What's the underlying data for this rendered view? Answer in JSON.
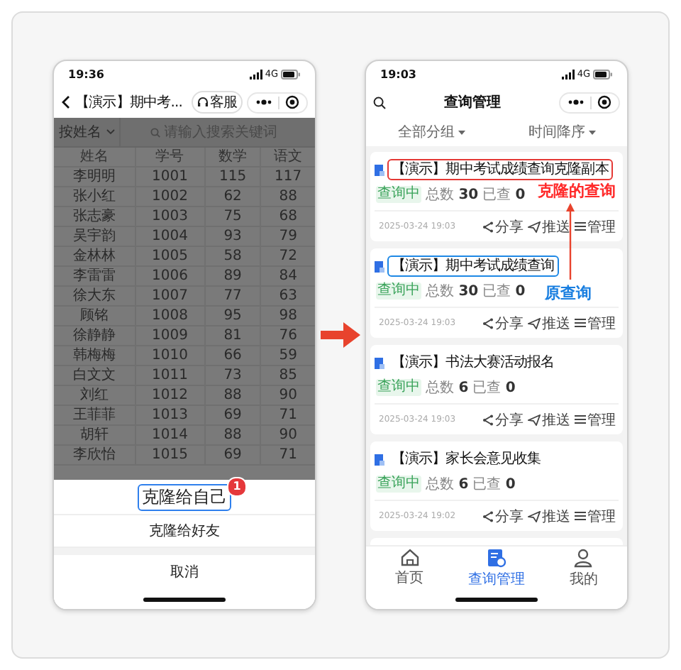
{
  "left_phone": {
    "status_bar": {
      "time": "19:36",
      "network": "4G"
    },
    "nav": {
      "title": "【演示】期中考...",
      "service_button": "客服"
    },
    "search": {
      "filter": "按姓名",
      "placeholder": "请输入搜索关键词"
    },
    "table": {
      "columns": [
        "姓名",
        "学号",
        "数学",
        "语文"
      ],
      "rows": [
        [
          "李明明",
          "1001",
          "115",
          "117"
        ],
        [
          "张小红",
          "1002",
          "62",
          "88"
        ],
        [
          "张志豪",
          "1003",
          "75",
          "68"
        ],
        [
          "吴宇韵",
          "1004",
          "93",
          "79"
        ],
        [
          "金林林",
          "1005",
          "58",
          "72"
        ],
        [
          "李雷雷",
          "1006",
          "89",
          "84"
        ],
        [
          "徐大东",
          "1007",
          "77",
          "63"
        ],
        [
          "顾铭",
          "1008",
          "95",
          "98"
        ],
        [
          "徐静静",
          "1009",
          "81",
          "76"
        ],
        [
          "韩梅梅",
          "1010",
          "66",
          "59"
        ],
        [
          "白文文",
          "1011",
          "73",
          "85"
        ],
        [
          "刘红",
          "1012",
          "88",
          "90"
        ],
        [
          "王菲菲",
          "1013",
          "69",
          "71"
        ],
        [
          "胡轩",
          "1014",
          "88",
          "90"
        ],
        [
          "李欣怡",
          "1015",
          "69",
          "71"
        ]
      ]
    },
    "action_sheet": {
      "items": [
        {
          "label": "克隆给自己",
          "highlighted": true,
          "badge": "1"
        },
        {
          "label": "克隆给好友",
          "highlighted": false
        }
      ],
      "cancel": "取消"
    }
  },
  "right_phone": {
    "status_bar": {
      "time": "19:03",
      "network": "4G"
    },
    "nav": {
      "title": "查询管理"
    },
    "filters": [
      "全部分组",
      "时间降序"
    ],
    "cards": [
      {
        "title": "【演示】期中考试成绩查询克隆副本",
        "color": "#e53935",
        "status": "查询中",
        "total_label": "总数",
        "total": "30",
        "checked_label": "已查",
        "checked": "0",
        "date": "2025-03-24 19:03",
        "actions": [
          "分享",
          "推送",
          "管理"
        ]
      },
      {
        "title": "【演示】期中考试成绩查询",
        "color": "#1e88e5",
        "status": "查询中",
        "total_label": "总数",
        "total": "30",
        "checked_label": "已查",
        "checked": "0",
        "date": "2025-03-24 19:03",
        "actions": [
          "分享",
          "推送",
          "管理"
        ]
      },
      {
        "title": "【演示】书法大赛活动报名",
        "status": "查询中",
        "total_label": "总数",
        "total": "6",
        "checked_label": "已查",
        "checked": "0",
        "date": "2025-03-24 19:03",
        "actions": [
          "分享",
          "推送",
          "管理"
        ]
      },
      {
        "title": "【演示】家长会意见收集",
        "status": "查询中",
        "total_label": "总数",
        "total": "6",
        "checked_label": "已查",
        "checked": "0",
        "date": "2025-03-24 19:02",
        "actions": [
          "分享",
          "推送",
          "管理"
        ]
      }
    ],
    "annotations": [
      {
        "text": "克隆的查询",
        "color": "#ff2a2a"
      },
      {
        "text": "原查询",
        "color": "#1a7fe0"
      }
    ],
    "tab_bar": [
      {
        "label": "首页",
        "selected": false
      },
      {
        "label": "查询管理",
        "selected": true
      },
      {
        "label": "我的",
        "selected": false
      }
    ]
  }
}
